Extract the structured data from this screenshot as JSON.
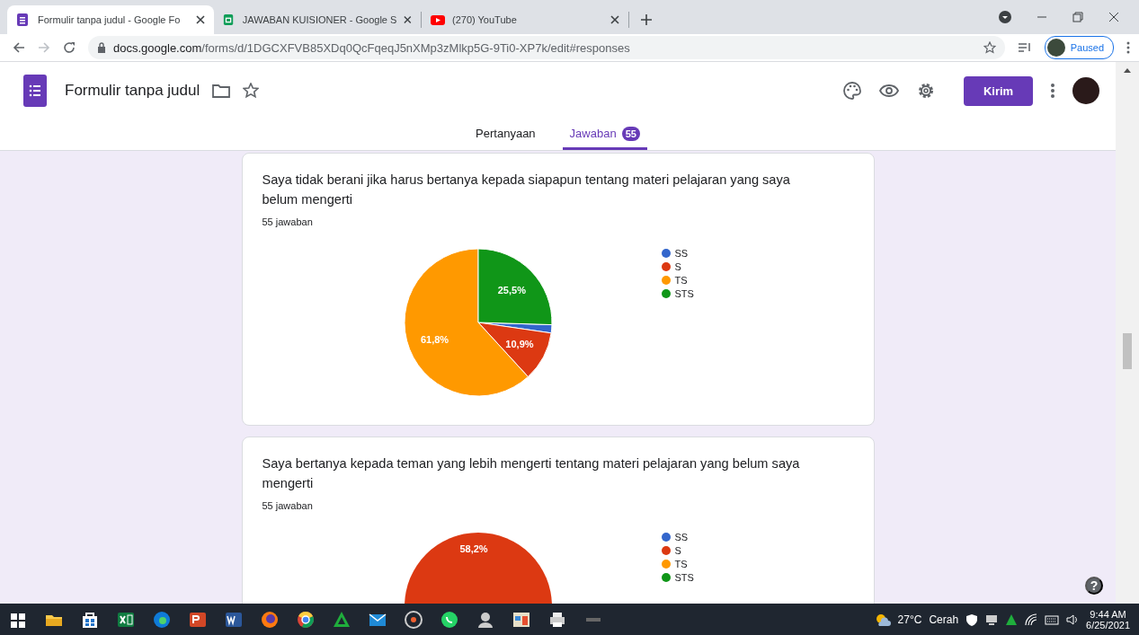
{
  "browser": {
    "tabs": [
      {
        "title": "Formulir tanpa judul - Google Fo",
        "kind": "forms",
        "selected": true
      },
      {
        "title": "JAWABAN KUISIONER - Google S",
        "kind": "sheets",
        "selected": false
      },
      {
        "title": "(270) YouTube",
        "kind": "video",
        "selected": false
      }
    ],
    "url": {
      "host": "docs.google.com",
      "path": "/forms/d/1DGCXFVB85XDq0QcFqeqJ5nXMp3zMlkp5G-9Ti0-XP7k/edit#responses"
    },
    "profile_status": "Paused"
  },
  "form": {
    "title": "Formulir tanpa judul",
    "send_button": "Kirim",
    "tabs": [
      {
        "label": "Pertanyaan",
        "selected": false
      },
      {
        "label": "Jawaban",
        "selected": true,
        "badge": "55"
      }
    ]
  },
  "questions": [
    {
      "text": "Saya tidak berani jika harus bertanya kepada siapapun tentang materi pelajaran yang saya belum mengerti",
      "count": "55 jawaban",
      "chart_data": {
        "type": "pie",
        "categories": [
          "SS",
          "S",
          "TS",
          "STS"
        ],
        "values": [
          1.8,
          10.9,
          61.8,
          25.5
        ],
        "colors": [
          "#3366cc",
          "#dc3912",
          "#ff9900",
          "#109618"
        ],
        "value_labels": [
          null,
          "10,9%",
          "61,8%",
          "25,5%"
        ]
      }
    },
    {
      "text": "Saya bertanya kepada teman yang lebih mengerti tentang materi pelajaran yang belum saya mengerti",
      "count": "55 jawaban",
      "legend": [
        {
          "label": "SS",
          "color": "#3366cc"
        },
        {
          "label": "S",
          "color": "#dc3912"
        },
        {
          "label": "TS",
          "color": "#ff9900"
        },
        {
          "label": "STS",
          "color": "#109618"
        }
      ],
      "visible_slice": {
        "label": "58,2%",
        "color": "#dc3912"
      }
    }
  ],
  "help": "?",
  "taskbar": {
    "weather": "27°C",
    "condition": "Cerah",
    "time": "9:44 AM",
    "date": "6/25/2021"
  }
}
